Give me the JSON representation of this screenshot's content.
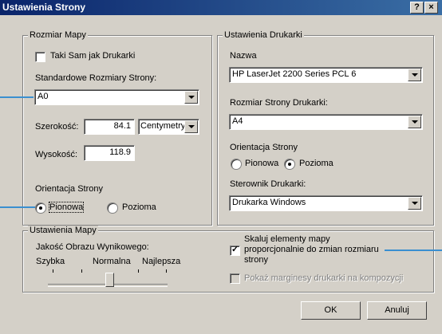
{
  "window": {
    "title": "Ustawienia Strony",
    "help": "?",
    "close": "×"
  },
  "map_size": {
    "legend": "Rozmiar Mapy",
    "same_as_printer_label": "Taki Sam jak Drukarki",
    "standard_sizes_label": "Standardowe Rozmiary Strony:",
    "standard_size_value": "A0",
    "width_label": "Szerokość:",
    "width_value": "84.1",
    "unit_value": "Centymetry",
    "height_label": "Wysokość:",
    "height_value": "118.9",
    "orientation_label": "Orientacja Strony",
    "portrait": "Pionowa",
    "landscape": "Pozioma"
  },
  "printer": {
    "legend": "Ustawienia Drukarki",
    "name_label": "Nazwa",
    "name_value": "HP LaserJet 2200 Series PCL 6",
    "paper_size_label": "Rozmiar Strony Drukarki:",
    "paper_size_value": "A4",
    "orientation_label": "Orientacja Strony",
    "portrait": "Pionowa",
    "landscape": "Pozioma",
    "driver_label": "Sterownik Drukarki:",
    "driver_value": "Drukarka Windows"
  },
  "map_settings": {
    "legend": "Ustawienia Mapy",
    "quality_label": "Jakość Obrazu Wynikowego:",
    "quality_low": "Szybka",
    "quality_normal": "Normalna",
    "quality_high": "Najlepsza",
    "quality_level": 0.5,
    "scale_label_line1": "Skaluj elementy mapy",
    "scale_label_line2": "proporcjonalnie do zmian rozmiaru",
    "scale_label_line3": "strony",
    "margins_label": "Pokaż marginesy drukarki na kompozycji"
  },
  "buttons": {
    "ok": "OK",
    "cancel": "Anuluj"
  },
  "colors": {
    "titlebar": "#0a246a",
    "callout": "#3a8fd0",
    "face": "#d4d0c8"
  }
}
